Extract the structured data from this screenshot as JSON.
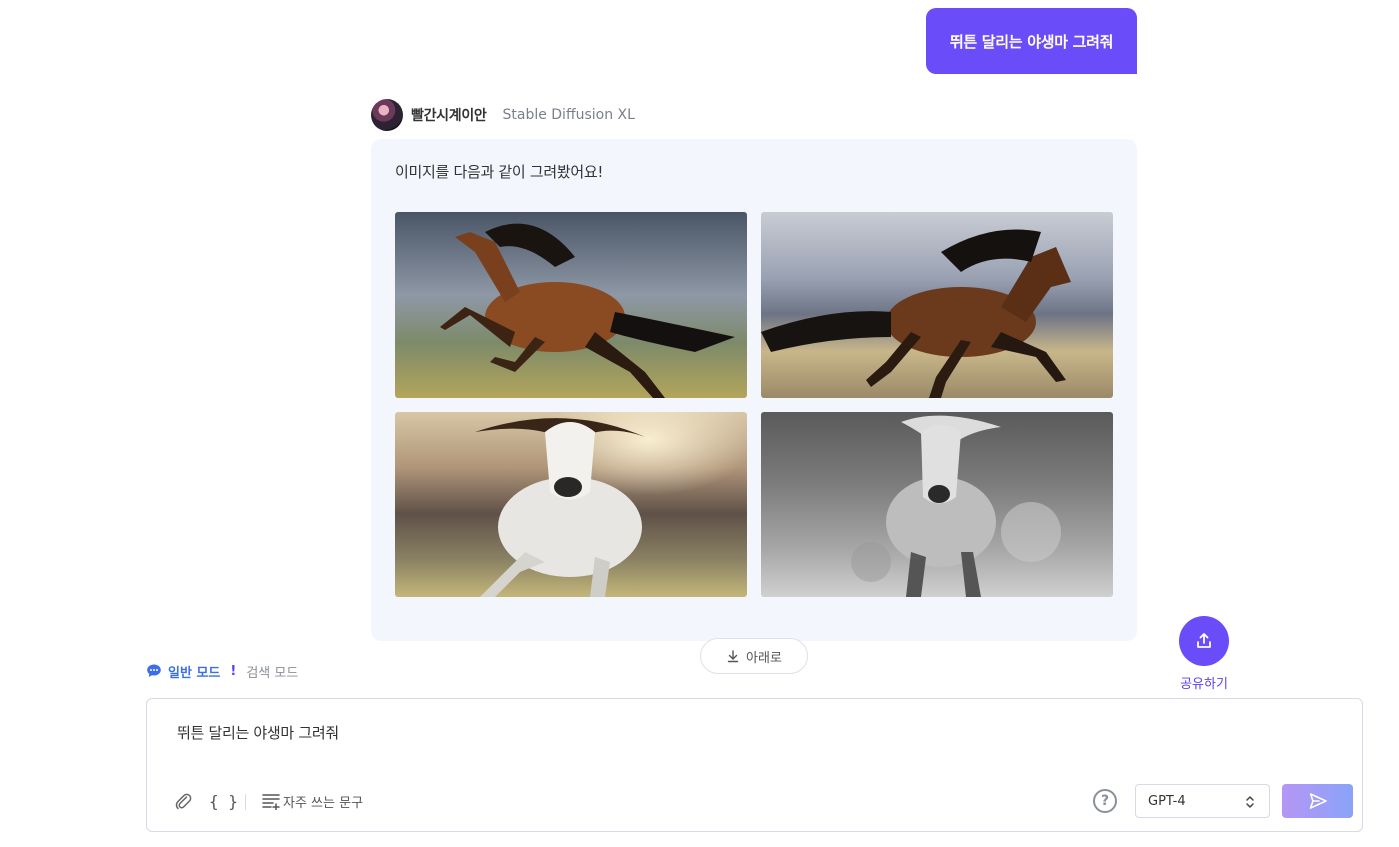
{
  "user_message": "뛰튼 달리는 야생마 그려줘",
  "assistant": {
    "name": "빨간시계이안",
    "model": "Stable Diffusion XL",
    "text": "이미지를 다음과 같이 그려봤어요!",
    "images": [
      "brown-horse-galloping-left",
      "brown-horse-galloping-right",
      "white-horse-running-front",
      "grayscale-horse-running-front"
    ]
  },
  "scroll_down_label": "아래로",
  "share_label": "공유하기",
  "modes": {
    "normal": "일반 모드",
    "separator": "!",
    "search": "검색 모드"
  },
  "input": {
    "value": "뛰튼 달리는 야생마 그려줘"
  },
  "toolbar": {
    "braces": "{ }",
    "phrases_label": "자주 쓰는 문구",
    "help": "?"
  },
  "model_select": {
    "value": "GPT-4"
  },
  "colors": {
    "accent": "#6a4cf9",
    "card_bg": "#f3f6fd",
    "mode_active": "#3b6ee8"
  }
}
